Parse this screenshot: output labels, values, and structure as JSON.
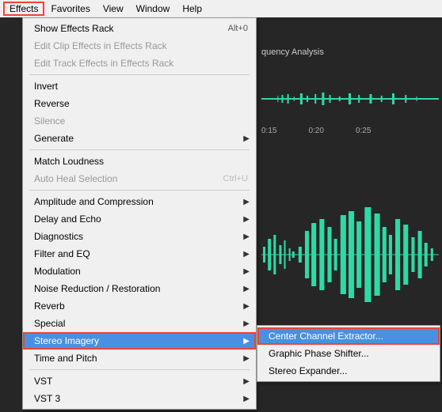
{
  "menubar": {
    "items": [
      "Effects",
      "Favorites",
      "View",
      "Window",
      "Help"
    ],
    "highlighted_index": 0
  },
  "panel": {
    "tab_label": "quency Analysis"
  },
  "timeline": {
    "marks": [
      "0:15",
      "0:20",
      "0:25"
    ]
  },
  "effects_menu": {
    "show_rack": "Show Effects Rack",
    "show_rack_shortcut": "Alt+0",
    "edit_clip": "Edit Clip Effects in Effects Rack",
    "edit_track": "Edit Track Effects in Effects Rack",
    "invert": "Invert",
    "reverse": "Reverse",
    "silence": "Silence",
    "generate": "Generate",
    "match_loudness": "Match Loudness",
    "auto_heal": "Auto Heal Selection",
    "auto_heal_shortcut": "Ctrl+U",
    "amplitude": "Amplitude and Compression",
    "delay": "Delay and Echo",
    "diagnostics": "Diagnostics",
    "filter_eq": "Filter and EQ",
    "modulation": "Modulation",
    "noise": "Noise Reduction / Restoration",
    "reverb": "Reverb",
    "special": "Special",
    "stereo_imagery": "Stereo Imagery",
    "time_pitch": "Time and Pitch",
    "vst": "VST",
    "vst3": "VST 3"
  },
  "stereo_submenu": {
    "center_extractor": "Center Channel Extractor...",
    "graphic_phase": "Graphic Phase Shifter...",
    "stereo_expander": "Stereo Expander..."
  }
}
